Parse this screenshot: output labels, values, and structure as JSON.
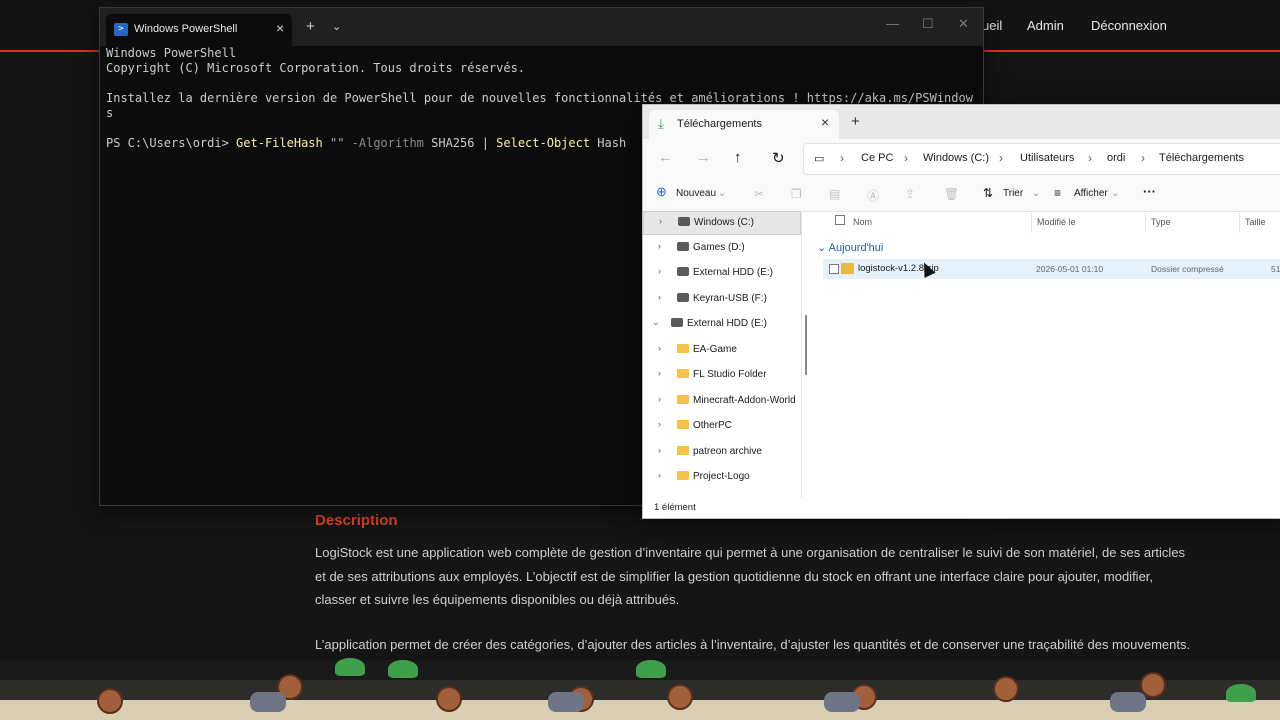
{
  "site": {
    "nav": {
      "accueil_partial": "ueil",
      "admin": "Admin",
      "logout": "Déconnexion"
    },
    "description_title": "Description",
    "paragraph1": "LogiStock est une application web complète de gestion d’inventaire qui permet à une organisation de centraliser le suivi de son matériel, de ses articles et de ses attributions aux employés. L’objectif est de simplifier la gestion quotidienne du stock en offrant une interface claire pour ajouter, modifier, classer et suivre les équipements disponibles ou déjà attribués.",
    "paragraph2": "L’application permet de créer des catégories, d’ajouter des articles à l’inventaire, d’ajuster les quantités et de conserver une traçabilité des mouvements. Elle permet aussi de gérer une liste d’employés avec une fiche détaillée pour chacun, incluant l’historique du matériel reçu et un accès rapide par code QR."
  },
  "powershell": {
    "tab_title": "Windows PowerShell",
    "tab_icon": "powershell-icon",
    "new_tab": "+",
    "dropdown": "⌄",
    "line1": "Windows PowerShell",
    "line2": "Copyright (C) Microsoft Corporation. Tous droits réservés.",
    "line3": "Installez la dernière version de PowerShell pour de nouvelles fonctionnalités et améliorations ! https://aka.ms/PSWindow",
    "line3_wrap": "s",
    "prompt": "PS C:\\Users\\ordi> ",
    "cmd": "Get-FileHash",
    "arg": " \"\" ",
    "param": "-Algorithm",
    "algo": " SHA256 | ",
    "cmd2": "Select-Object",
    "tail": " Hash"
  },
  "explorer": {
    "tab_title": "Téléchargements",
    "tab_icon": "download-icon",
    "breadcrumbs": [
      "Ce PC",
      "Windows (C:)",
      "Utilisateurs",
      "ordi",
      "Téléchargements"
    ],
    "toolbar": {
      "new": "Nouveau",
      "sort": "Trier",
      "view": "Afficher",
      "more": "···"
    },
    "sidebar": [
      {
        "label": "Windows (C:)",
        "type": "drive",
        "selected": true
      },
      {
        "label": "Games (D:)",
        "type": "drive"
      },
      {
        "label": "External HDD (E:)",
        "type": "drive"
      },
      {
        "label": "Keyran-USB (F:)",
        "type": "drive"
      },
      {
        "label": "External HDD (E:)",
        "type": "drive",
        "expanded": true
      },
      {
        "label": "EA-Game",
        "type": "folder"
      },
      {
        "label": "FL Studio Folder",
        "type": "folder"
      },
      {
        "label": "Minecraft-Addon-World",
        "type": "folder"
      },
      {
        "label": "OtherPC",
        "type": "folder"
      },
      {
        "label": "patreon archive",
        "type": "folder"
      },
      {
        "label": "Project-Logo",
        "type": "folder"
      }
    ],
    "columns": {
      "name": "Nom",
      "modified": "Modifié le",
      "type": "Type",
      "size": "Taille"
    },
    "group": "Aujourd'hui",
    "file": {
      "name": "logistock-v1.2.8.zip",
      "modified": "2026-05-01 01:10",
      "type": "Dossier compressé",
      "size": "51"
    },
    "status": "1 élément"
  }
}
